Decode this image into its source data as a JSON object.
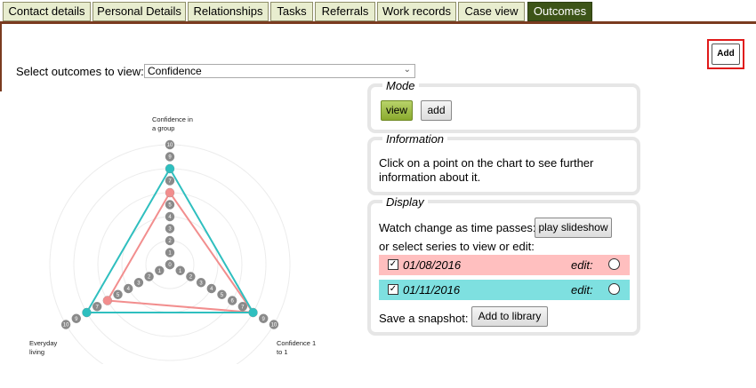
{
  "tabs": [
    {
      "label": "Contact details",
      "active": false
    },
    {
      "label": "Personal Details",
      "active": false
    },
    {
      "label": "Relationships",
      "active": false
    },
    {
      "label": "Tasks",
      "active": false
    },
    {
      "label": "Referrals",
      "active": false
    },
    {
      "label": "Work records",
      "active": false
    },
    {
      "label": "Case view",
      "active": false
    },
    {
      "label": "Outcomes",
      "active": true
    }
  ],
  "add_button_label": "Add",
  "select_label": "Select outcomes to view:",
  "select_value": "Confidence",
  "mode": {
    "legend": "Mode",
    "view_label": "view",
    "add_label": "add",
    "selected": "view"
  },
  "information": {
    "legend": "Information",
    "line1": "Click on a point on the chart to see further",
    "line2": "information about it."
  },
  "display": {
    "legend": "Display",
    "watch_label": "Watch change as time passes:",
    "slideshow_label": "play slideshow",
    "or_select_label": "or select series to view or edit:",
    "series": [
      {
        "date": "01/08/2016",
        "edit_label": "edit:",
        "checked": true,
        "color": "#ffbfbf"
      },
      {
        "date": "01/11/2016",
        "edit_label": "edit:",
        "checked": true,
        "color": "#7ee0e0"
      }
    ],
    "snapshot_label": "Save a snapshot:",
    "library_label": "Add to library"
  },
  "chart_data": {
    "type": "radar",
    "axes": [
      {
        "label_lines": [
          "Confidence in",
          "a group"
        ]
      },
      {
        "label_lines": [
          "Confidence 1",
          "to 1"
        ]
      },
      {
        "label_lines": [
          "Everyday",
          "living"
        ]
      }
    ],
    "scale": [
      0,
      10
    ],
    "tick_values": [
      0,
      1,
      2,
      3,
      4,
      5,
      6,
      7,
      8,
      9,
      10
    ],
    "series": [
      {
        "name": "01/08/2016",
        "color": "#f28e8e",
        "values": [
          6,
          8,
          6
        ]
      },
      {
        "name": "01/11/2016",
        "color": "#2fbfbf",
        "values": [
          8,
          8,
          8
        ]
      }
    ]
  }
}
